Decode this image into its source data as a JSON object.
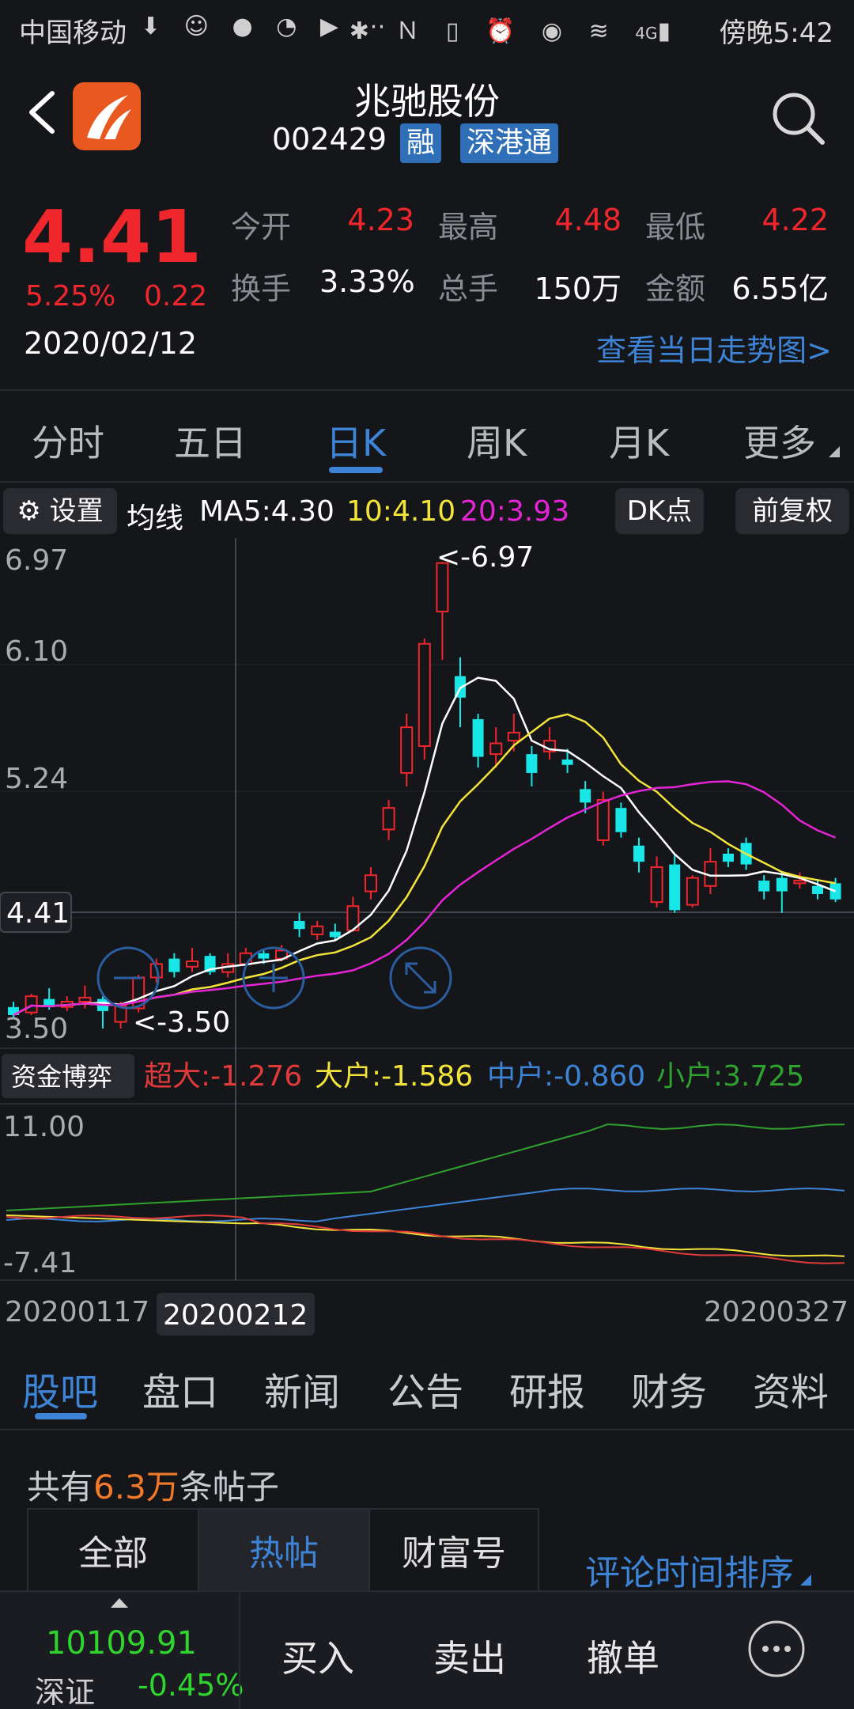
{
  "status_bar": {
    "carrier": "中国移动",
    "network": "4G",
    "time": "傍晚5:42"
  },
  "header": {
    "name": "兆驰股份",
    "code": "002429",
    "tags": [
      "融",
      "深港通"
    ]
  },
  "quote": {
    "price": "4.41",
    "change_pct": "5.25%",
    "change": "0.22",
    "date": "2020/02/12",
    "stats": [
      {
        "label": "今开",
        "value": "4.23",
        "color": "red"
      },
      {
        "label": "最高",
        "value": "4.48",
        "color": "red"
      },
      {
        "label": "最低",
        "value": "4.22",
        "color": "red"
      },
      {
        "label": "换手",
        "value": "3.33%",
        "color": "white"
      },
      {
        "label": "总手",
        "value": "150万",
        "color": "white"
      },
      {
        "label": "金额",
        "value": "6.55亿",
        "color": "white"
      }
    ],
    "trend_link": "查看当日走势图>"
  },
  "period_tabs": [
    "分时",
    "五日",
    "日K",
    "周K",
    "月K",
    "更多"
  ],
  "period_active": "日K",
  "ma_bar": {
    "settings": "设置",
    "ma_label": "均线",
    "ma5": "MA5:4.30",
    "ma10": "10:4.10",
    "ma20": "20:3.93",
    "dk_button": "DK点",
    "adjust_button": "前复权"
  },
  "kline": {
    "y_labels": [
      "6.97",
      "6.10",
      "5.24",
      "4.41",
      "3.50"
    ],
    "high_marker": "<-6.97",
    "low_marker": "<-3.50",
    "current_price_label": "4.41"
  },
  "fund_flow": {
    "button": "资金博弈",
    "super_large": "超大:-1.276",
    "large": "大户:-1.586",
    "medium": "中户:-0.860",
    "small": "小户:3.725",
    "y_top": "11.00",
    "y_bottom": "-7.41",
    "date_start": "20200117",
    "date_cursor": "20200212",
    "date_end": "20200327"
  },
  "colors": {
    "up": "#f0262d",
    "down": "#19e6e6",
    "ma5": "#ffffff",
    "ma10": "#f2e43a",
    "ma20": "#e524d6",
    "accent": "#3d84d6",
    "small_flow": "#2fa12f",
    "medium_flow": "#3d84d6",
    "large_flow": "#f2e43a",
    "super_flow": "#e03a3a"
  },
  "bottom_tabs": [
    "股吧",
    "盘口",
    "新闻",
    "公告",
    "研报",
    "财务",
    "资料"
  ],
  "bottom_active": "股吧",
  "posts": {
    "count_prefix": "共有",
    "count": "6.3万",
    "count_suffix": "条帖子",
    "filters": [
      "全部",
      "热帖",
      "财富号"
    ],
    "filter_active": "热帖",
    "sort": "评论时间排序"
  },
  "footer": {
    "index_value": "10109.91",
    "index_name": "深证",
    "index_change": "-0.45%",
    "buy": "买入",
    "sell": "卖出",
    "cancel": "撤单"
  }
}
